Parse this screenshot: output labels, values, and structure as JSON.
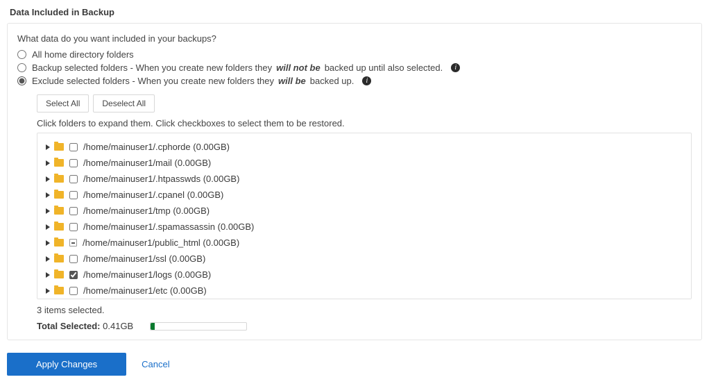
{
  "title": "Data Included in Backup",
  "question": "What data do you want included in your backups?",
  "options": {
    "all": {
      "label": "All home directory folders"
    },
    "backup_selected": {
      "pre": "Backup selected folders - When you create new folders they ",
      "emph": "will not be",
      "post": " backed up until also selected."
    },
    "exclude_selected": {
      "pre": "Exclude selected folders - When you create new folders they ",
      "emph": "will be",
      "post": " backed up."
    }
  },
  "buttons": {
    "select_all": "Select All",
    "deselect_all": "Deselect All"
  },
  "instruction": "Click folders to expand them. Click checkboxes to select them to be restored.",
  "folders": [
    {
      "path": "/home/mainuser1/.cphorde (0.00GB)",
      "checked": false
    },
    {
      "path": "/home/mainuser1/mail (0.00GB)",
      "checked": false
    },
    {
      "path": "/home/mainuser1/.htpasswds (0.00GB)",
      "checked": false
    },
    {
      "path": "/home/mainuser1/.cpanel (0.00GB)",
      "checked": false
    },
    {
      "path": "/home/mainuser1/tmp (0.00GB)",
      "checked": false
    },
    {
      "path": "/home/mainuser1/.spamassassin (0.00GB)",
      "checked": false
    },
    {
      "path": "/home/mainuser1/public_html (0.00GB)",
      "indeterminate": true
    },
    {
      "path": "/home/mainuser1/ssl (0.00GB)",
      "checked": false
    },
    {
      "path": "/home/mainuser1/logs (0.00GB)",
      "checked": true
    },
    {
      "path": "/home/mainuser1/etc (0.00GB)",
      "checked": false
    }
  ],
  "selected_status": "3 items selected.",
  "total": {
    "label": "Total Selected:",
    "value": "0.41GB"
  },
  "actions": {
    "apply": "Apply Changes",
    "cancel": "Cancel"
  }
}
